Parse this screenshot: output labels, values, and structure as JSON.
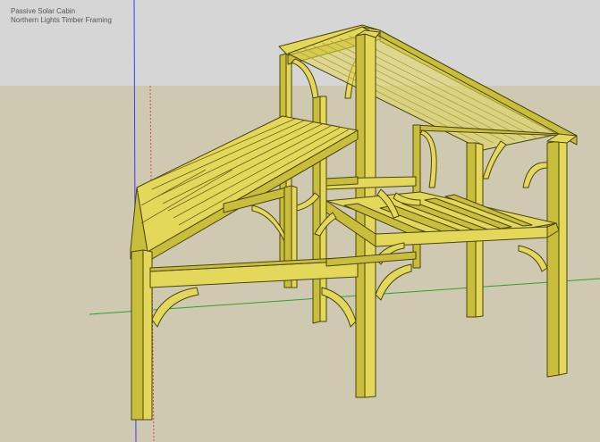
{
  "model": {
    "title": "Passive Solar Cabin",
    "subtitle": "Northern Lights Timber Framing"
  },
  "colors": {
    "sky": "#d6d6d6",
    "ground": "#cfc9b1",
    "timber": "#e3d85a",
    "timber_shade": "#c9bd3c",
    "timber_dark": "#a89c28",
    "edge": "#4a4510",
    "axis_blue": "#3a3aff",
    "axis_green": "#2ea02e",
    "axis_red": "#d04a4a"
  }
}
